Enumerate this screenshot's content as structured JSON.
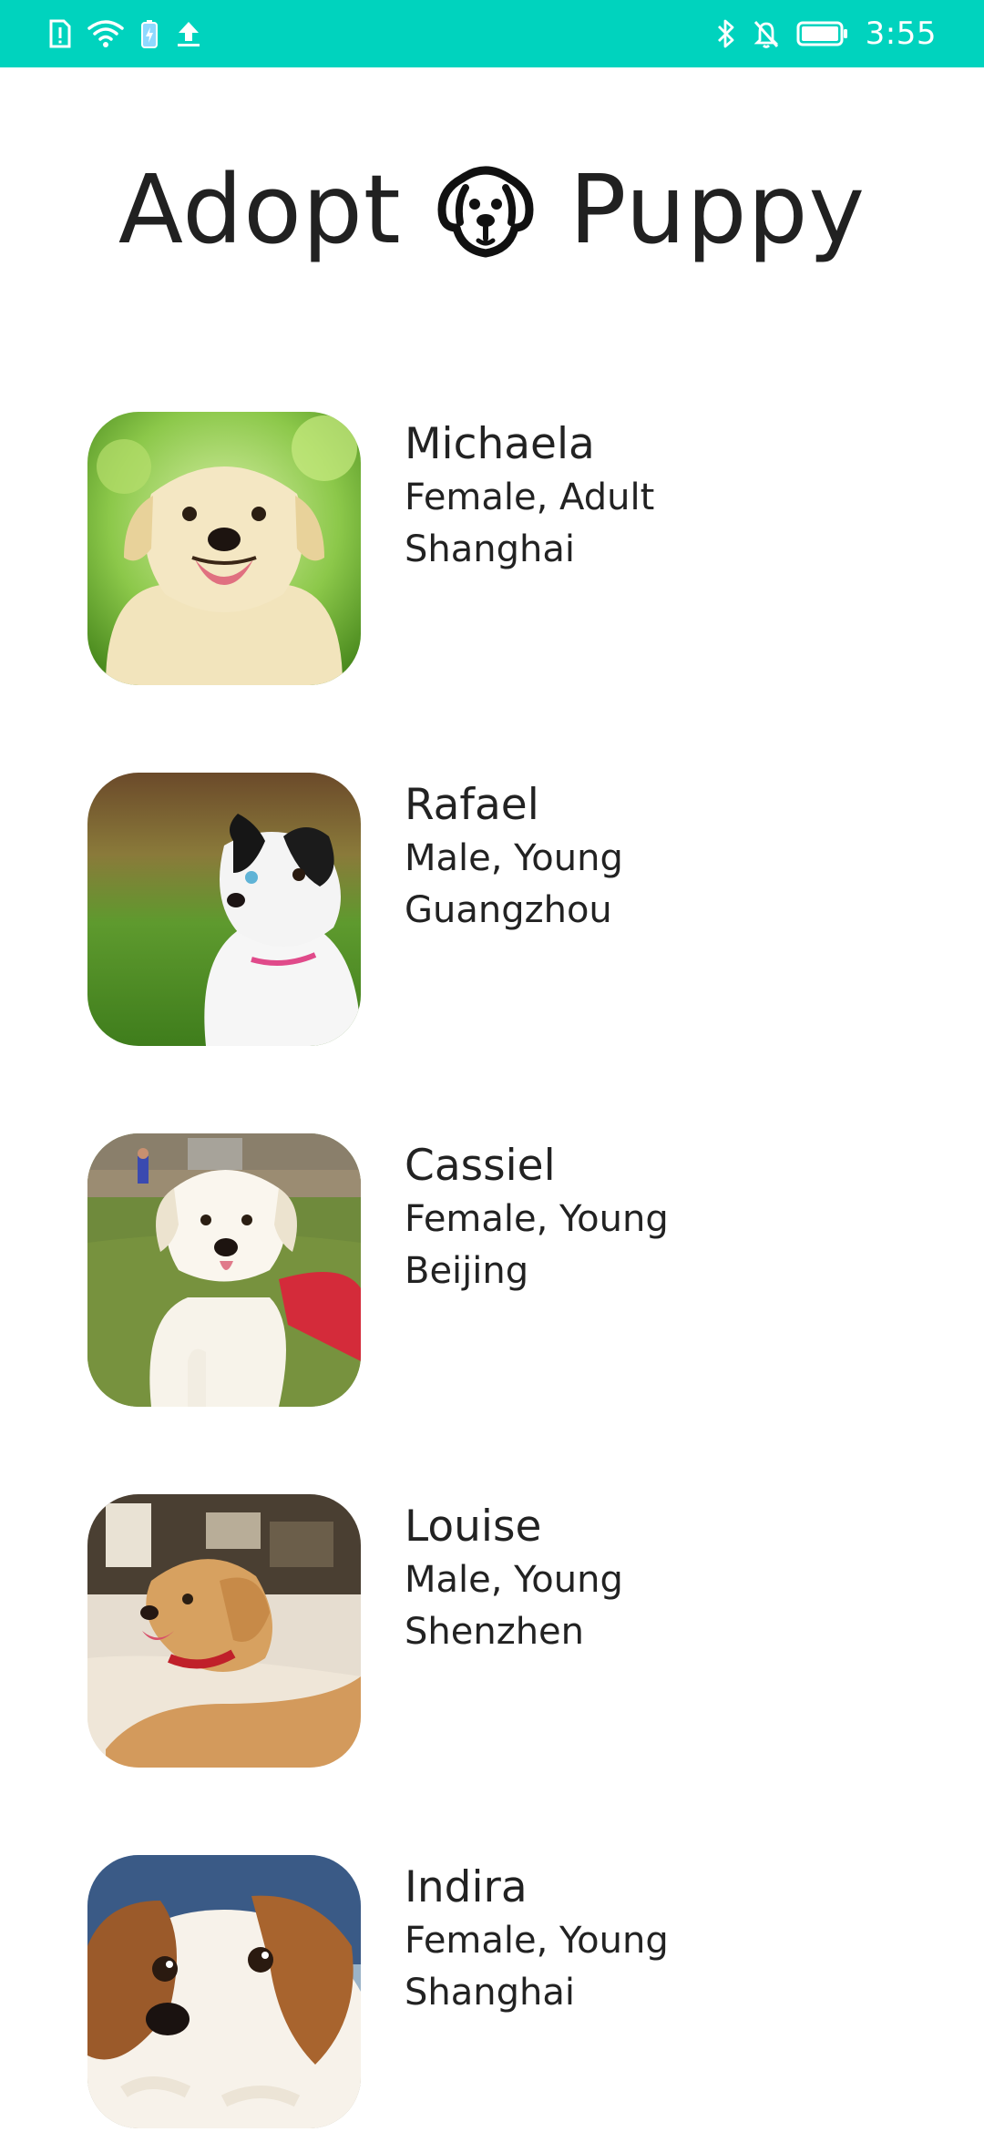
{
  "status_bar": {
    "background": "#00d3be",
    "left_icons": [
      "sim-alert-icon",
      "wifi-icon",
      "battery-saver-icon",
      "upload-icon"
    ],
    "right_icons": [
      "bluetooth-icon",
      "notifications-off-icon",
      "battery-icon"
    ],
    "time": "3:55"
  },
  "header": {
    "title_left": "Adopt",
    "title_icon": "dog-face-icon",
    "title_right": "Puppy"
  },
  "puppies": [
    {
      "name": "Michaela",
      "gender_age": "Female, Adult",
      "city": "Shanghai",
      "photo_icon": "labrador-puppy-photo"
    },
    {
      "name": "Rafael",
      "gender_age": "Male, Young",
      "city": "Guangzhou",
      "photo_icon": "border-collie-puppy-photo"
    },
    {
      "name": "Cassiel",
      "gender_age": "Female, Young",
      "city": "Beijing",
      "photo_icon": "white-lab-puppy-photo"
    },
    {
      "name": "Louise",
      "gender_age": "Male, Young",
      "city": "Shenzhen",
      "photo_icon": "golden-retriever-puppy-photo"
    },
    {
      "name": "Indira",
      "gender_age": "Female, Young",
      "city": "Shanghai",
      "photo_icon": "cavalier-puppy-photo"
    }
  ]
}
